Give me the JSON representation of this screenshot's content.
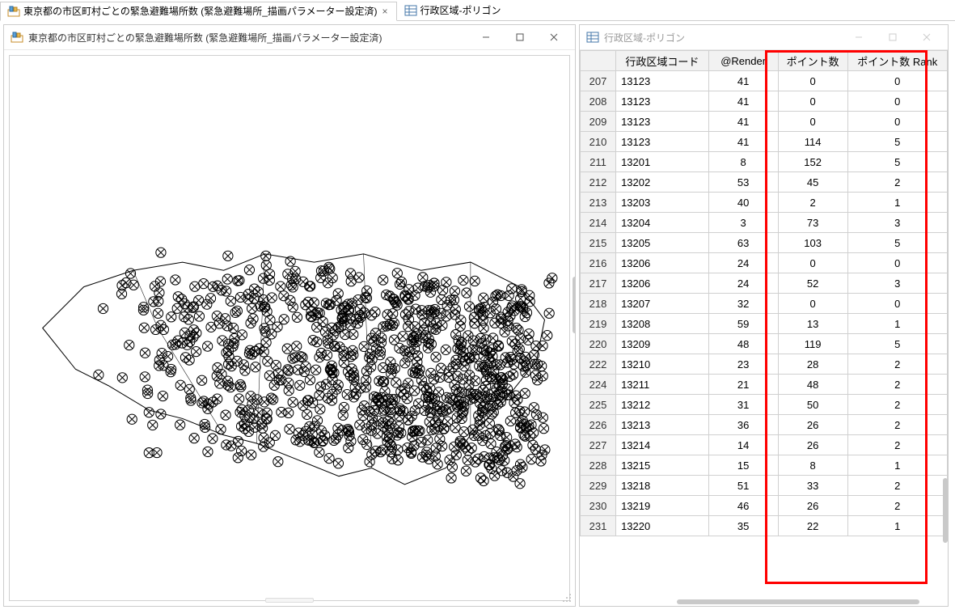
{
  "tabs": [
    {
      "label": "東京都の市区町村ごとの緊急避難場所数 (緊急避難場所_描画パラメーター設定済)",
      "icon": "map-icon",
      "active": true,
      "closable": true
    },
    {
      "label": "行政区域-ポリゴン",
      "icon": "table-icon",
      "active": false,
      "closable": false
    }
  ],
  "left_panel": {
    "title": "東京都の市区町村ごとの緊急避難場所数 (緊急避難場所_描画パラメーター設定済)"
  },
  "right_panel": {
    "title": "行政区域-ポリゴン",
    "columns": [
      "行政区域コード",
      "@Render",
      "ポイント数",
      "ポイント数 Rank"
    ],
    "rows": [
      {
        "n": "207",
        "code": "13123",
        "render": "41",
        "points": "0",
        "rank": "0"
      },
      {
        "n": "208",
        "code": "13123",
        "render": "41",
        "points": "0",
        "rank": "0"
      },
      {
        "n": "209",
        "code": "13123",
        "render": "41",
        "points": "0",
        "rank": "0"
      },
      {
        "n": "210",
        "code": "13123",
        "render": "41",
        "points": "114",
        "rank": "5"
      },
      {
        "n": "211",
        "code": "13201",
        "render": "8",
        "points": "152",
        "rank": "5"
      },
      {
        "n": "212",
        "code": "13202",
        "render": "53",
        "points": "45",
        "rank": "2"
      },
      {
        "n": "213",
        "code": "13203",
        "render": "40",
        "points": "2",
        "rank": "1"
      },
      {
        "n": "214",
        "code": "13204",
        "render": "3",
        "points": "73",
        "rank": "3"
      },
      {
        "n": "215",
        "code": "13205",
        "render": "63",
        "points": "103",
        "rank": "5"
      },
      {
        "n": "216",
        "code": "13206",
        "render": "24",
        "points": "0",
        "rank": "0"
      },
      {
        "n": "217",
        "code": "13206",
        "render": "24",
        "points": "52",
        "rank": "3"
      },
      {
        "n": "218",
        "code": "13207",
        "render": "32",
        "points": "0",
        "rank": "0"
      },
      {
        "n": "219",
        "code": "13208",
        "render": "59",
        "points": "13",
        "rank": "1"
      },
      {
        "n": "220",
        "code": "13209",
        "render": "48",
        "points": "119",
        "rank": "5"
      },
      {
        "n": "222",
        "code": "13210",
        "render": "23",
        "points": "28",
        "rank": "2"
      },
      {
        "n": "224",
        "code": "13211",
        "render": "21",
        "points": "48",
        "rank": "2"
      },
      {
        "n": "225",
        "code": "13212",
        "render": "31",
        "points": "50",
        "rank": "2"
      },
      {
        "n": "226",
        "code": "13213",
        "render": "36",
        "points": "26",
        "rank": "2"
      },
      {
        "n": "227",
        "code": "13214",
        "render": "14",
        "points": "26",
        "rank": "2"
      },
      {
        "n": "228",
        "code": "13215",
        "render": "15",
        "points": "8",
        "rank": "1"
      },
      {
        "n": "229",
        "code": "13218",
        "render": "51",
        "points": "33",
        "rank": "2"
      },
      {
        "n": "230",
        "code": "13219",
        "render": "46",
        "points": "26",
        "rank": "2"
      },
      {
        "n": "231",
        "code": "13220",
        "render": "35",
        "points": "22",
        "rank": "1"
      }
    ]
  },
  "chart_data": {
    "type": "table",
    "title": "行政区域-ポリゴン",
    "columns": [
      "行政区域コード",
      "@Render",
      "ポイント数",
      "ポイント数 Rank"
    ],
    "rows": [
      [
        "13123",
        41,
        0,
        0
      ],
      [
        "13123",
        41,
        0,
        0
      ],
      [
        "13123",
        41,
        0,
        0
      ],
      [
        "13123",
        41,
        114,
        5
      ],
      [
        "13201",
        8,
        152,
        5
      ],
      [
        "13202",
        53,
        45,
        2
      ],
      [
        "13203",
        40,
        2,
        1
      ],
      [
        "13204",
        3,
        73,
        3
      ],
      [
        "13205",
        63,
        103,
        5
      ],
      [
        "13206",
        24,
        0,
        0
      ],
      [
        "13206",
        24,
        52,
        3
      ],
      [
        "13207",
        32,
        0,
        0
      ],
      [
        "13208",
        59,
        13,
        1
      ],
      [
        "13209",
        48,
        119,
        5
      ],
      [
        "13210",
        23,
        28,
        2
      ],
      [
        "13211",
        21,
        48,
        2
      ],
      [
        "13212",
        31,
        50,
        2
      ],
      [
        "13213",
        36,
        26,
        2
      ],
      [
        "13214",
        14,
        26,
        2
      ],
      [
        "13215",
        15,
        8,
        1
      ],
      [
        "13218",
        51,
        33,
        2
      ],
      [
        "13219",
        46,
        26,
        2
      ],
      [
        "13220",
        35,
        22,
        1
      ]
    ]
  }
}
